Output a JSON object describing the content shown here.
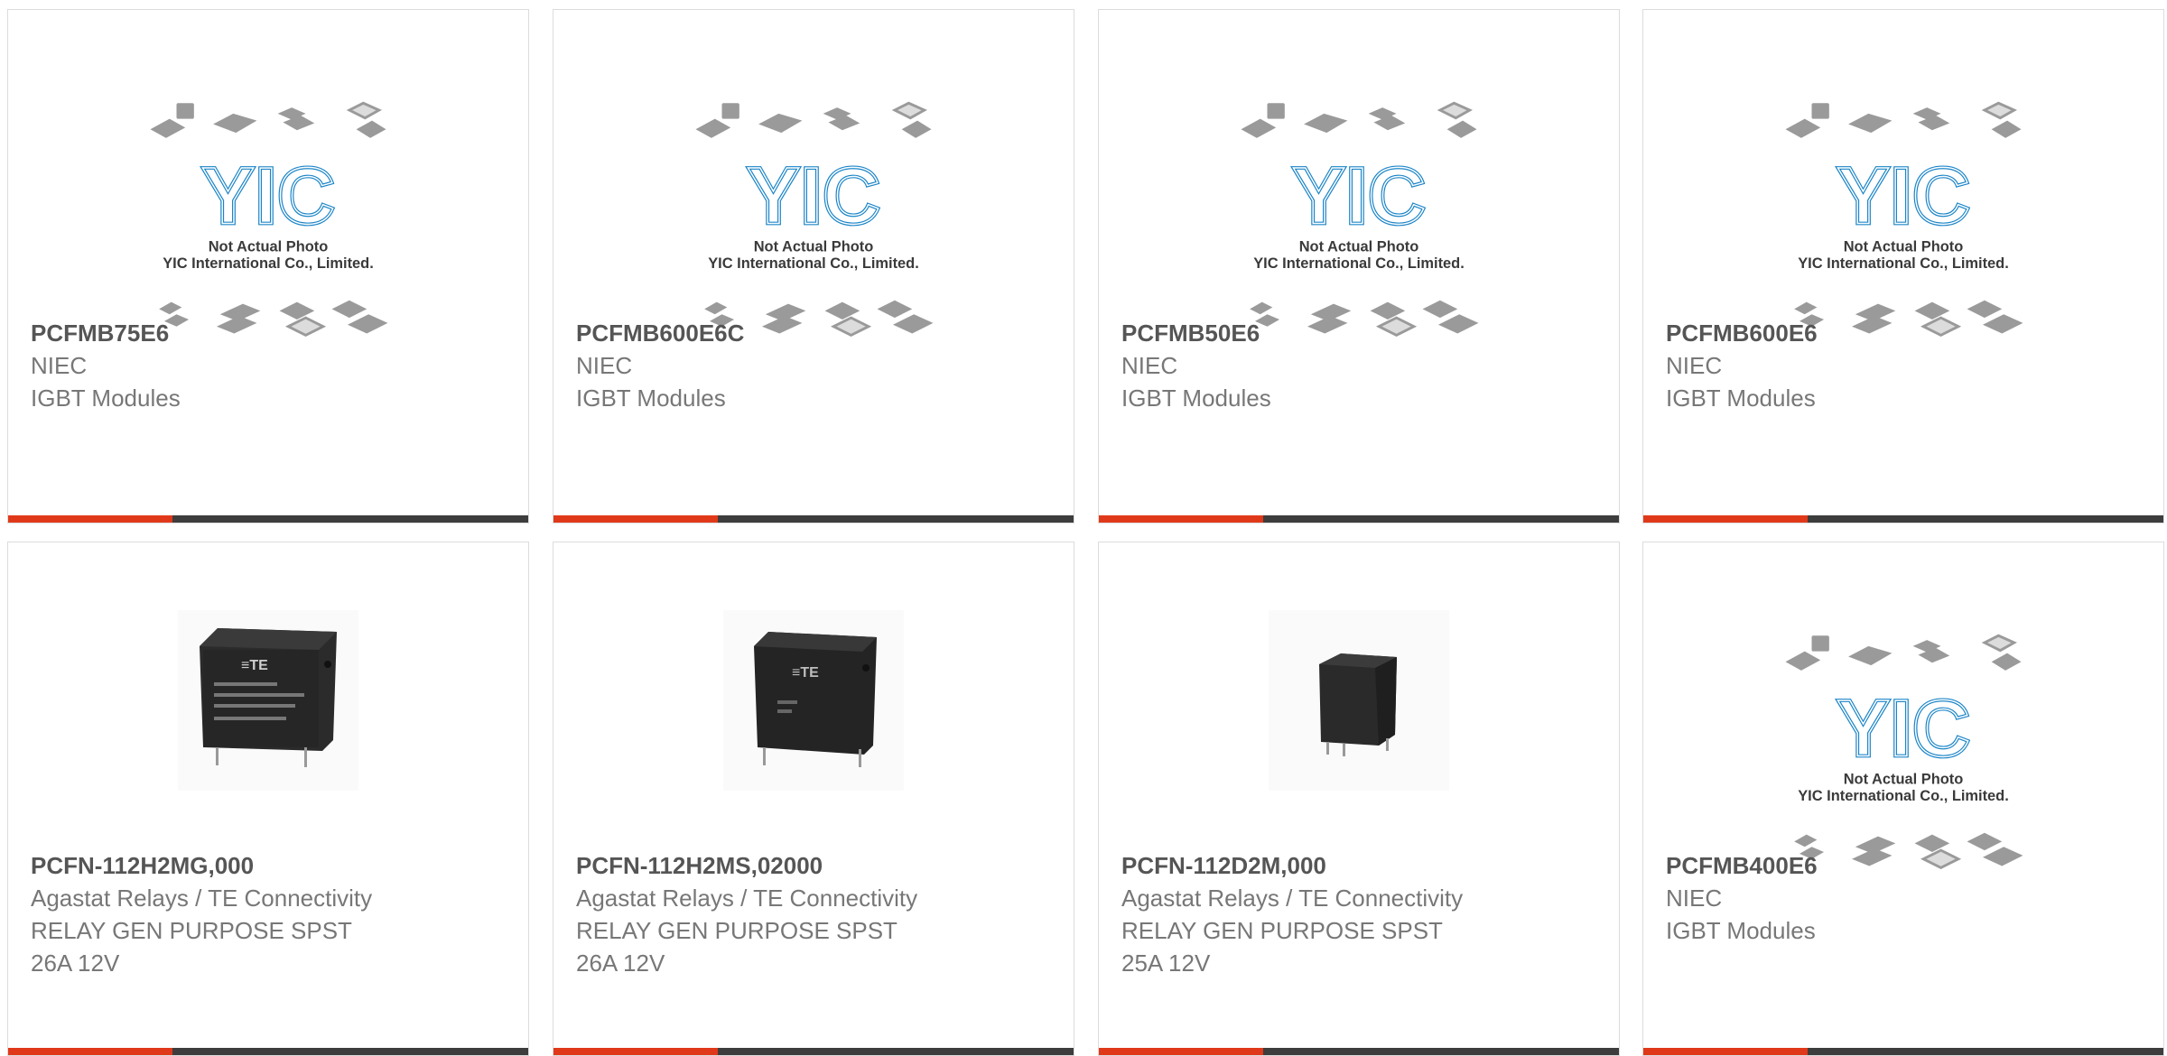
{
  "colors": {
    "accent": "#e0391a",
    "bar": "#3d3d3d",
    "border": "#dcdcdc",
    "title": "#555555",
    "text": "#777777",
    "logo": "#1a84c7"
  },
  "placeholder": {
    "line1": "Not Actual Photo",
    "line2": "YIC International Co., Limited.",
    "logo": "YIC"
  },
  "products": [
    {
      "part": "PCFMB75E6",
      "lines": [
        "NIEC",
        "IGBT Modules"
      ],
      "image": "placeholder"
    },
    {
      "part": "PCFMB600E6C",
      "lines": [
        "NIEC",
        "IGBT Modules"
      ],
      "image": "placeholder"
    },
    {
      "part": "PCFMB50E6",
      "lines": [
        "NIEC",
        "IGBT Modules"
      ],
      "image": "placeholder"
    },
    {
      "part": "PCFMB600E6",
      "lines": [
        "NIEC",
        "IGBT Modules"
      ],
      "image": "placeholder"
    },
    {
      "part": "PCFN-112H2MG,000",
      "lines": [
        "Agastat Relays / TE Connectivity",
        "RELAY GEN PURPOSE SPST",
        "26A 12V"
      ],
      "image": "relay-wide"
    },
    {
      "part": "PCFN-112H2MS,02000",
      "lines": [
        "Agastat Relays / TE Connectivity",
        "RELAY GEN PURPOSE SPST",
        "26A 12V"
      ],
      "image": "relay-narrow"
    },
    {
      "part": "PCFN-112D2M,000",
      "lines": [
        "Agastat Relays / TE Connectivity",
        "RELAY GEN PURPOSE SPST",
        "25A 12V"
      ],
      "image": "relay-small"
    },
    {
      "part": "PCFMB400E6",
      "lines": [
        "NIEC",
        "IGBT Modules"
      ],
      "image": "placeholder"
    }
  ]
}
